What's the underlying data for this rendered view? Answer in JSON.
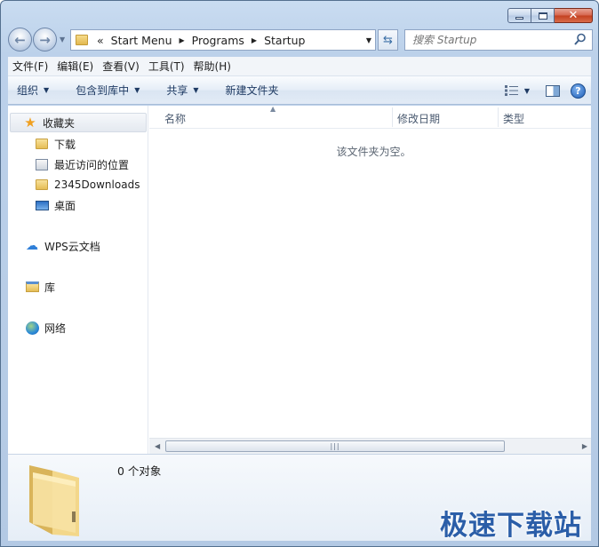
{
  "address": {
    "overflow": "«",
    "crumbs": [
      "Start Menu",
      "Programs",
      "Startup"
    ]
  },
  "search": {
    "placeholder": "搜索 Startup"
  },
  "menubar": {
    "items": [
      "文件(F)",
      "编辑(E)",
      "查看(V)",
      "工具(T)",
      "帮助(H)"
    ]
  },
  "commands": {
    "organize": "组织",
    "include_in_library": "包含到库中",
    "share": "共享",
    "new_folder": "新建文件夹"
  },
  "navpane": {
    "favorites": "收藏夹",
    "favorite_items": [
      "下载",
      "最近访问的位置",
      "2345Downloads",
      "桌面"
    ],
    "wps": "WPS云文档",
    "libraries": "库",
    "network": "网络"
  },
  "columns": {
    "name": "名称",
    "modified": "修改日期",
    "type": "类型"
  },
  "empty_message": "该文件夹为空。",
  "details": {
    "count": "0 个对象"
  },
  "watermark": "极速下载站",
  "colors": {
    "accent": "#2b5ea8",
    "window_frame": "#bcd1ea"
  }
}
